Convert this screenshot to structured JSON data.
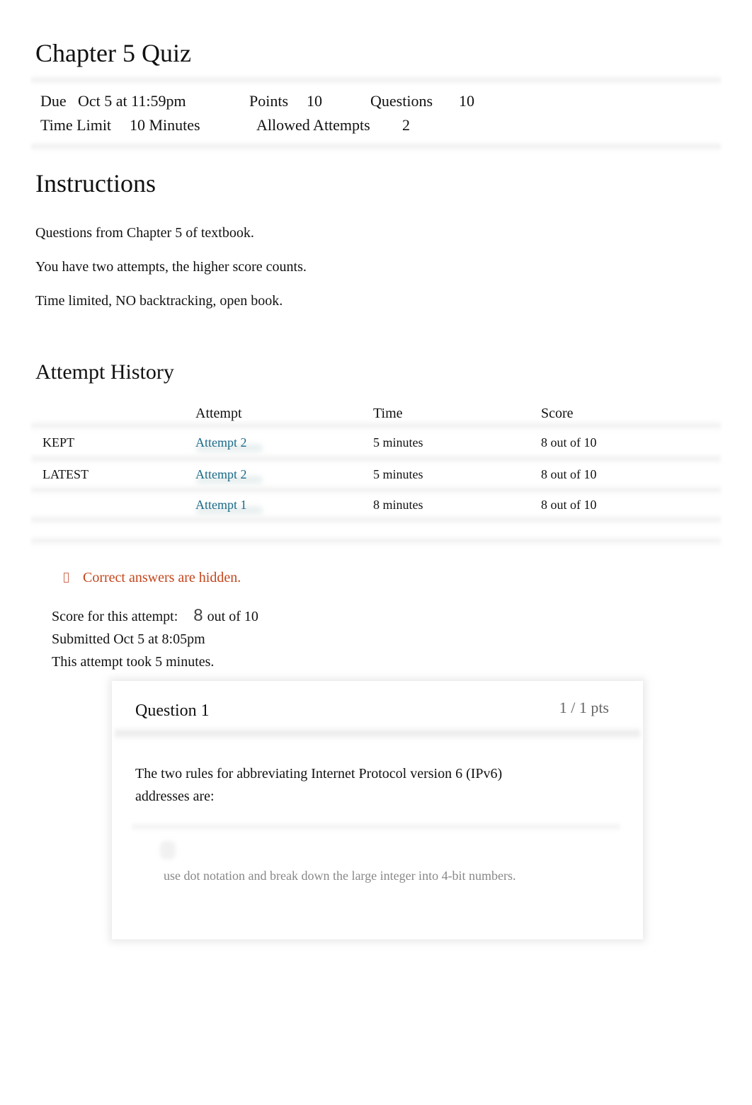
{
  "quiz": {
    "title": "Chapter 5 Quiz",
    "details": {
      "due_label": "Due",
      "due_value": "Oct 5 at 11:59pm",
      "points_label": "Points",
      "points_value": "10",
      "questions_label": "Questions",
      "questions_value": "10",
      "time_limit_label": "Time Limit",
      "time_limit_value": "10 Minutes",
      "allowed_attempts_label": "Allowed Attempts",
      "allowed_attempts_value": "2"
    }
  },
  "instructions": {
    "heading": "Instructions",
    "paragraphs": [
      "Questions from Chapter 5 of textbook.",
      "You have two attempts, the higher score counts.",
      "Time limited, NO backtracking, open book."
    ]
  },
  "attempt_history": {
    "heading": "Attempt History",
    "columns": [
      "",
      "Attempt",
      "Time",
      "Score"
    ],
    "rows": [
      {
        "tag": "KEPT",
        "attempt": "Attempt 2",
        "time": "5 minutes",
        "score": "8 out of 10"
      },
      {
        "tag": "LATEST",
        "attempt": "Attempt 2",
        "time": "5 minutes",
        "score": "8 out of 10"
      },
      {
        "tag": "",
        "attempt": "Attempt 1",
        "time": "8 minutes",
        "score": "8 out of 10"
      }
    ]
  },
  "notice": {
    "icon": "info-icon",
    "text": "Correct answers are hidden.",
    "color": "#c4451c"
  },
  "attempt_summary": {
    "score_label": "Score for this attempt:",
    "score_value": "8",
    "score_suffix": "out of 10",
    "submitted": "Submitted Oct 5 at 8:05pm",
    "duration": "This attempt took 5 minutes."
  },
  "questions": [
    {
      "title": "Question 1",
      "points": "1 / 1 pts",
      "text": "The two rules for abbreviating Internet Protocol version 6 (IPv6) addresses are:",
      "answers": [
        "use dot notation and break down the large integer into 4-bit numbers."
      ]
    }
  ],
  "colors": {
    "link": "#1a6a8a",
    "notice": "#c4451c",
    "muted": "#888888"
  }
}
